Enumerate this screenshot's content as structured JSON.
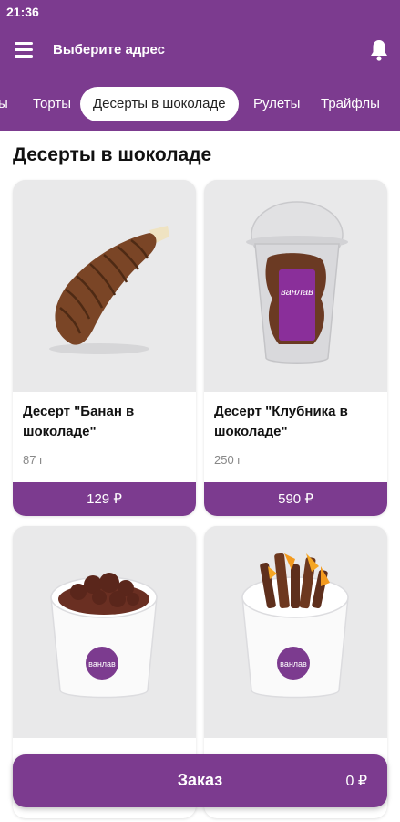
{
  "status_bar": {
    "time": "21:36"
  },
  "header": {
    "address_label": "Выберите адрес",
    "brand_color": "#7c3b8f"
  },
  "tabs": [
    {
      "label": "ы"
    },
    {
      "label": "Торты"
    },
    {
      "label": "Десерты в шоколаде",
      "active": true
    },
    {
      "label": "Рулеты"
    },
    {
      "label": "Трайфлы"
    }
  ],
  "section": {
    "title": "Десерты в шоколаде"
  },
  "products": [
    {
      "title": "Десерт \"Банан в шоколаде\"",
      "weight": "87 г",
      "price": "129 ₽",
      "image": "chocolate-banana"
    },
    {
      "title": "Десерт \"Клубника в шоколаде\"",
      "weight": "250 г",
      "price": "590 ₽",
      "image": "strawberry-cup",
      "cup_brand": "ванлав"
    },
    {
      "title": "",
      "weight": "",
      "price": "",
      "image": "nuts-cup",
      "cup_brand": "ванлав"
    },
    {
      "title": "",
      "weight": "",
      "price": "",
      "image": "orange-cup",
      "cup_brand": "ванлав"
    }
  ],
  "order": {
    "label": "Заказ",
    "sum": "0 ₽"
  }
}
